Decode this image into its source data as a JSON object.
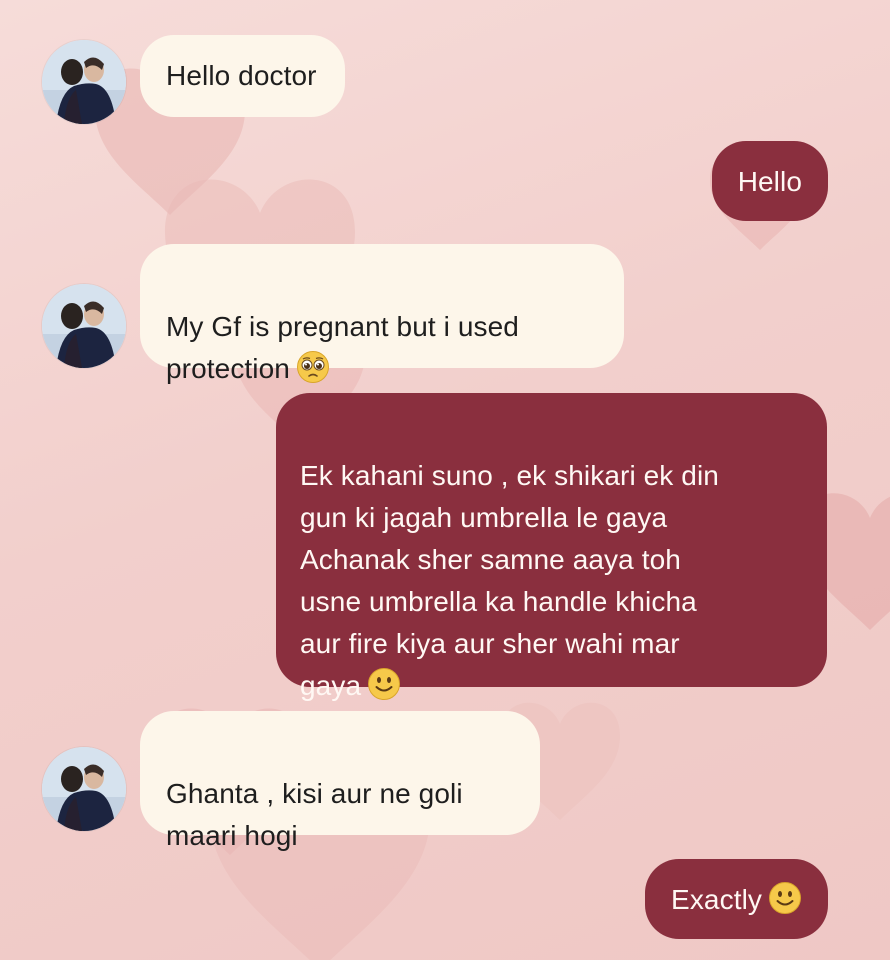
{
  "colors": {
    "incoming_bubble": "#fdf6ea",
    "outgoing_bubble": "#8a2f3e",
    "background": "#f2cfcc"
  },
  "messages": [
    {
      "side": "incoming",
      "text": "Hello doctor"
    },
    {
      "side": "outgoing",
      "text": "Hello"
    },
    {
      "side": "incoming",
      "text": "My Gf is pregnant but i used\nprotection",
      "emoji": "pleading-face-emoji"
    },
    {
      "side": "outgoing",
      "text": "Ek kahani suno , ek shikari ek din\ngun ki jagah umbrella le gaya\nAchanak sher samne aaya toh\nusne umbrella ka handle khicha\naur fire kiya aur sher wahi mar\ngaya",
      "emoji": "slightly-smiling-face-emoji"
    },
    {
      "side": "incoming",
      "text": "Ghanta , kisi aur ne goli\nmaari hogi"
    },
    {
      "side": "outgoing",
      "text": "Exactly",
      "emoji": "slightly-smiling-face-emoji"
    }
  ]
}
